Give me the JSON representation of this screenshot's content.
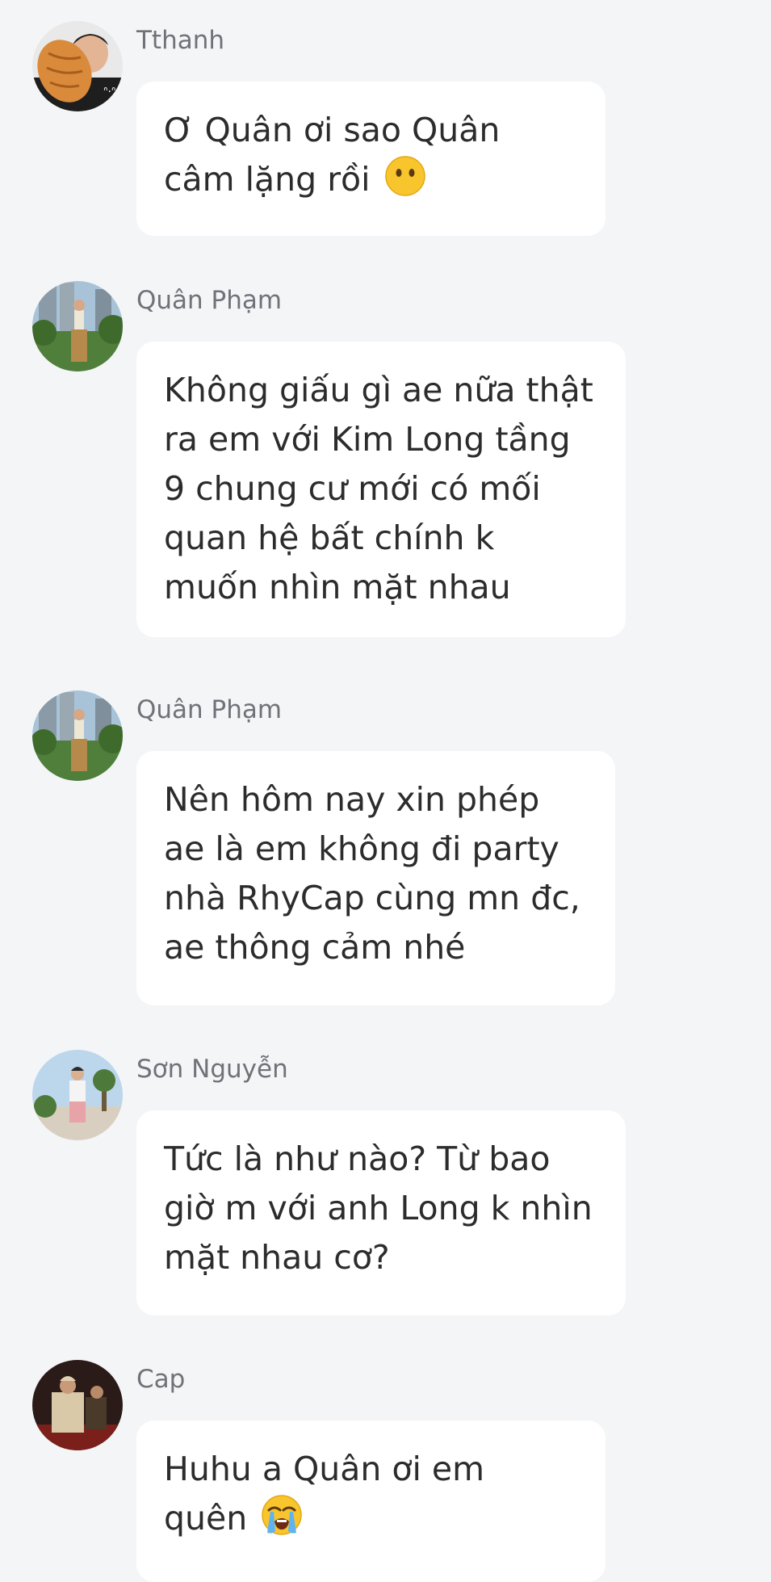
{
  "messages": [
    {
      "sender": "Tthanh",
      "avatar_icon": "avatar-tthanh",
      "text": "Ơ Quân ơi sao Quân câm lặng rồi",
      "emoji": "face-without-mouth"
    },
    {
      "sender": "Quân Phạm",
      "avatar_icon": "avatar-quan-pham",
      "text": "Không giấu gì ae nữa thật ra em với Kim Long tầng 9 chung cư mới có mối quan hệ bất chính k muốn nhìn mặt nhau",
      "emoji": ""
    },
    {
      "sender": "Quân Phạm",
      "avatar_icon": "avatar-quan-pham",
      "text": "Nên hôm nay xin phép ae là em không đi party nhà RhyCap cùng mn đc, ae thông cảm nhé",
      "emoji": ""
    },
    {
      "sender": "Sơn Nguyễn",
      "avatar_icon": "avatar-son-nguyen",
      "text": "Tức là như nào? Từ bao giờ m với anh Long k nhìn mặt nhau cơ?",
      "emoji": ""
    },
    {
      "sender": "Cap",
      "avatar_icon": "avatar-cap",
      "text": "Huhu a Quân ơi em quên",
      "emoji": "loudly-crying-face"
    }
  ]
}
